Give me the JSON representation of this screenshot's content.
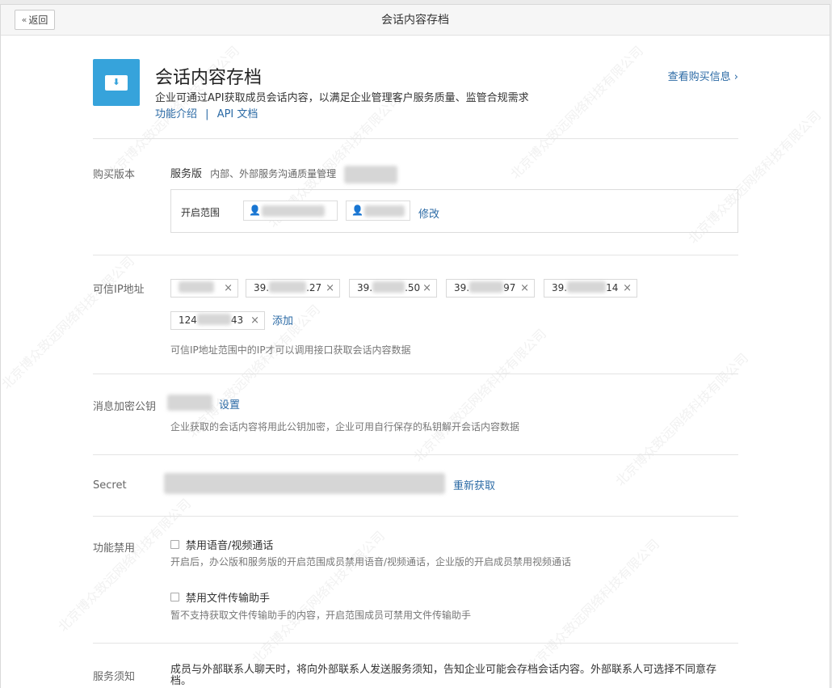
{
  "topbar": {
    "back_label": "返回",
    "title": "会话内容存档"
  },
  "app": {
    "title": "会话内容存档",
    "description": "企业可通过API获取成员会话内容，以满足企业管理客户服务质量、监管合规需求",
    "link_intro": "功能介绍",
    "link_sep": "|",
    "link_api": "API 文档",
    "buy_info": "查看购买信息",
    "logo_icon": "download-box-icon",
    "accent_color": "#36a3db"
  },
  "purchase": {
    "label": "购买版本",
    "version_name": "服务版",
    "version_desc": "内部、外部服务沟通质量管理",
    "scope_label": "开启范围",
    "scope_edit": "修改"
  },
  "ip": {
    "label": "可信IP地址",
    "items": [
      {
        "prefix": "",
        "suffix": ""
      },
      {
        "prefix": "39.",
        "suffix": ".27"
      },
      {
        "prefix": "39.",
        "suffix": ".50"
      },
      {
        "prefix": "39.",
        "suffix": "97"
      },
      {
        "prefix": "39.",
        "suffix": "14"
      },
      {
        "prefix": "124",
        "suffix": "43"
      }
    ],
    "add": "添加",
    "hint": "可信IP地址范围中的IP才可以调用接口获取会话内容数据"
  },
  "key": {
    "label": "消息加密公钥",
    "set": "设置",
    "hint": "企业获取的会话内容将用此公钥加密，企业可用自行保存的私钥解开会话内容数据"
  },
  "secret": {
    "label": "Secret",
    "refetch": "重新获取"
  },
  "disable": {
    "label": "功能禁用",
    "opt1": "禁用语音/视频通话",
    "opt1_hint": "开启后，办公版和服务版的开启范围成员禁用语音/视频通话，企业版的开启成员禁用视频通话",
    "opt2": "禁用文件传输助手",
    "opt2_hint": "暂不支持获取文件传输助手的内容，开启范围成员可禁用文件传输助手"
  },
  "notice": {
    "label": "服务须知",
    "text": "成员与外部联系人聊天时，将向外部联系人发送服务须知，告知企业可能会存档会话内容。外部联系人可选择不同意存档。"
  },
  "watermark": "北京博众致远网络科技有限公司"
}
